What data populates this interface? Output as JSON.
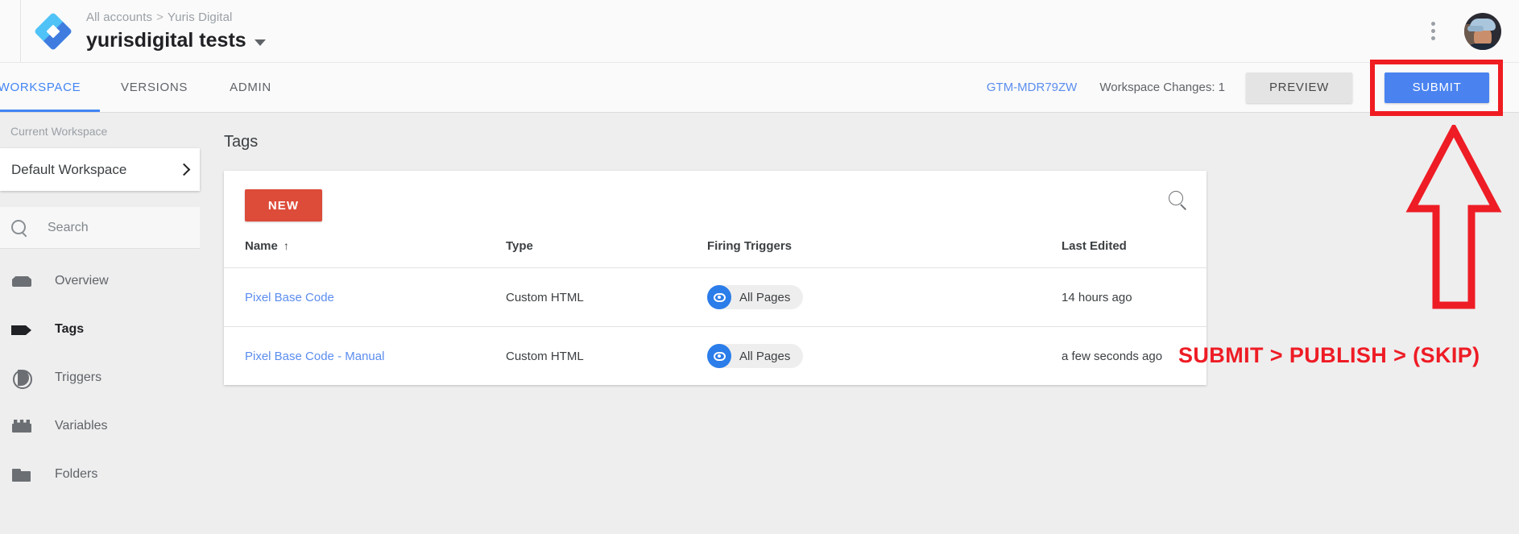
{
  "header": {
    "breadcrumb_root": "All accounts",
    "breadcrumb_sep": ">",
    "breadcrumb_account": "Yuris Digital",
    "container_name": "yurisdigital tests",
    "logo_icon": "gtm-diamond-logo",
    "caret_icon": "chevron-down-icon",
    "kebab_icon": "more-vert-icon",
    "avatar_icon": "user-avatar"
  },
  "nav": {
    "tabs": [
      {
        "label": "WORKSPACE",
        "active": true
      },
      {
        "label": "VERSIONS",
        "active": false
      },
      {
        "label": "ADMIN",
        "active": false
      }
    ],
    "container_id": "GTM-MDR79ZW",
    "workspace_changes": "Workspace Changes: 1",
    "preview_label": "PREVIEW",
    "submit_label": "SUBMIT"
  },
  "sidebar": {
    "section_label": "Current Workspace",
    "workspace_name": "Default Workspace",
    "workspace_chevron_icon": "chevron-right-icon",
    "search_icon": "search-icon",
    "search_placeholder": "Search",
    "search_value": "",
    "items": [
      {
        "label": "Overview",
        "icon": "overview-icon",
        "active": false
      },
      {
        "label": "Tags",
        "icon": "tag-icon",
        "active": true
      },
      {
        "label": "Triggers",
        "icon": "trigger-icon",
        "active": false
      },
      {
        "label": "Variables",
        "icon": "variable-icon",
        "active": false
      },
      {
        "label": "Folders",
        "icon": "folder-icon",
        "active": false
      }
    ]
  },
  "main": {
    "page_title": "Tags",
    "new_button_label": "NEW",
    "card_search_icon": "search-icon",
    "columns": {
      "name": "Name",
      "name_sort_arrow": "↑",
      "type": "Type",
      "firing_triggers": "Firing Triggers",
      "last_edited": "Last Edited"
    },
    "rows": [
      {
        "name": "Pixel Base Code",
        "type": "Custom HTML",
        "trigger": "All Pages",
        "trigger_icon": "pageview-eye-icon",
        "last_edited": "14 hours ago"
      },
      {
        "name": "Pixel Base Code - Manual",
        "type": "Custom HTML",
        "trigger": "All Pages",
        "trigger_icon": "pageview-eye-icon",
        "last_edited": "a few seconds ago"
      }
    ]
  },
  "annotation": {
    "arrow_icon": "up-arrow-outline-annotation",
    "text": "SUBMIT > PUBLISH > (SKIP)",
    "color": "#ee1c25"
  }
}
